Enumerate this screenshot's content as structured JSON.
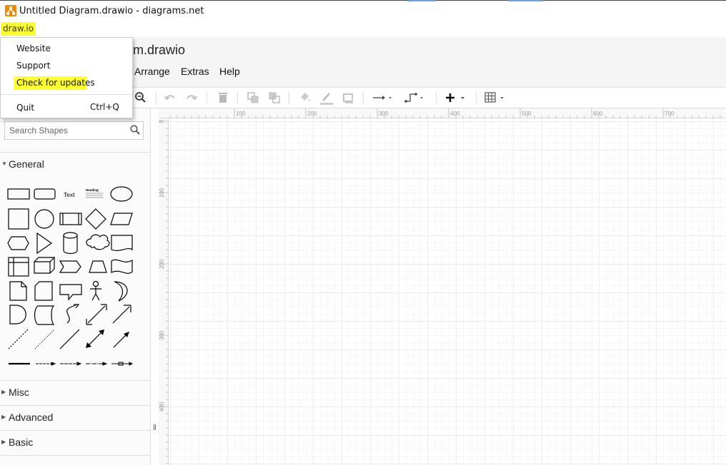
{
  "window": {
    "title": "Untitled Diagram.drawio - diagrams.net",
    "app_menu_label": "draw.io"
  },
  "header": {
    "doc_title": "m.drawio",
    "menus": [
      "Arrange",
      "Extras",
      "Help"
    ]
  },
  "dropdown": {
    "items": [
      {
        "label": "Website"
      },
      {
        "label": "Support"
      },
      {
        "label": "Check for updates",
        "highlighted": true
      },
      {
        "label": "Quit",
        "shortcut": "Ctrl+Q"
      }
    ]
  },
  "sidebar": {
    "search_placeholder": "Search Shapes",
    "sections": [
      {
        "label": "General",
        "expanded": true
      },
      {
        "label": "Misc",
        "expanded": false
      },
      {
        "label": "Advanced",
        "expanded": false
      },
      {
        "label": "Basic",
        "expanded": false
      }
    ],
    "shape_text_label": "Text",
    "shape_heading_label": "Heading"
  },
  "rulers": {
    "top": [
      "100",
      "200",
      "300",
      "400",
      "500",
      "600",
      "700"
    ],
    "left": [
      "0",
      "100",
      "200",
      "300",
      "400"
    ]
  },
  "colors": {
    "highlight": "#ffff2e",
    "brand": "#f08705",
    "canvas_grid": "#ececec"
  },
  "toolbar_icons": [
    "zoom-out-icon",
    "undo-icon",
    "redo-icon",
    "delete-icon",
    "to-front-icon",
    "to-back-icon",
    "fill-color-icon",
    "line-color-icon",
    "shadow-icon",
    "connection-icon",
    "waypoints-icon",
    "insert-icon",
    "table-icon"
  ]
}
